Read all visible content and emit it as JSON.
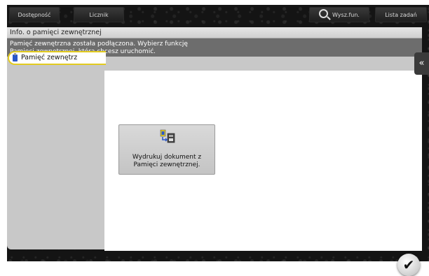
{
  "topbar": {
    "accessibility_label": "Dostępność",
    "counter_label": "Licznik",
    "search_label": "Wysz.fun.",
    "joblist_label": "Lista zadań"
  },
  "title": "Info. o pamięci zewnętrznej",
  "message": {
    "line1": "Pamięć zewnętrzna została podłączona. Wybierz funkcję",
    "line2": "Pamięci zewnętrznej, którą chcesz uruchomić."
  },
  "sidebar": {
    "tab_label": "Pamięć zewnętrz"
  },
  "function_button": {
    "line1": "Wydrukuj dokument z",
    "line2": "Pamięci zewnętrznej."
  },
  "icons": {
    "usb": "usb-memory-icon",
    "print": "print-from-memory-icon",
    "search": "search-icon",
    "collapse": "double-chevron-left-icon",
    "ok": "checkmark-icon"
  },
  "colors": {
    "tab_highlight": "#e3cb1f",
    "message_bar": "#6d6d6d",
    "usb_blue": "#2a57c9"
  }
}
